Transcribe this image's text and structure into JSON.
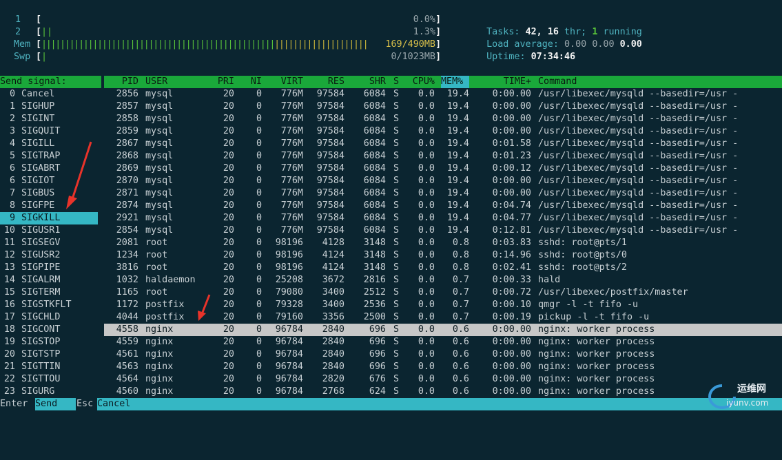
{
  "meters": {
    "cpu1": {
      "label": "1",
      "bar": "",
      "value": "0.0%"
    },
    "cpu2": {
      "label": "2",
      "bar": "||",
      "value": "1.3%"
    },
    "mem": {
      "label": "Mem",
      "bar_green": "||||||||||||||||||||||||||||||||||||||||||||||||||",
      "bar_yellow": "||||||||||||||||||||",
      "value": "169/490MB"
    },
    "swp": {
      "label": "Swp",
      "bar": "|",
      "value": "0/1023MB"
    }
  },
  "stats": {
    "tasks_label": "Tasks:",
    "tasks_count": "42,",
    "threads": "16",
    "thr_label": "thr;",
    "running": "1",
    "running_label": "running",
    "load_label": "Load average:",
    "load1": "0.00",
    "load5": "0.00",
    "load15": "0.00",
    "uptime_label": "Uptime:",
    "uptime": "07:34:46"
  },
  "signal_panel": {
    "title": "Send signal:",
    "items": [
      {
        "num": "0",
        "name": "Cancel"
      },
      {
        "num": "1",
        "name": "SIGHUP"
      },
      {
        "num": "2",
        "name": "SIGINT"
      },
      {
        "num": "3",
        "name": "SIGQUIT"
      },
      {
        "num": "4",
        "name": "SIGILL"
      },
      {
        "num": "5",
        "name": "SIGTRAP"
      },
      {
        "num": "6",
        "name": "SIGABRT"
      },
      {
        "num": "6",
        "name": "SIGIOT"
      },
      {
        "num": "7",
        "name": "SIGBUS"
      },
      {
        "num": "8",
        "name": "SIGFPE"
      },
      {
        "num": "9",
        "name": "SIGKILL"
      },
      {
        "num": "10",
        "name": "SIGUSR1"
      },
      {
        "num": "11",
        "name": "SIGSEGV"
      },
      {
        "num": "12",
        "name": "SIGUSR2"
      },
      {
        "num": "13",
        "name": "SIGPIPE"
      },
      {
        "num": "14",
        "name": "SIGALRM"
      },
      {
        "num": "15",
        "name": "SIGTERM"
      },
      {
        "num": "16",
        "name": "SIGSTKFLT"
      },
      {
        "num": "17",
        "name": "SIGCHLD"
      },
      {
        "num": "18",
        "name": "SIGCONT"
      },
      {
        "num": "19",
        "name": "SIGSTOP"
      },
      {
        "num": "20",
        "name": "SIGTSTP"
      },
      {
        "num": "21",
        "name": "SIGTTIN"
      },
      {
        "num": "22",
        "name": "SIGTTOU"
      },
      {
        "num": "23",
        "name": "SIGURG"
      }
    ],
    "selected_index": 10
  },
  "table": {
    "columns": [
      "PID",
      "USER",
      "PRI",
      "NI",
      "VIRT",
      "RES",
      "SHR",
      "S",
      "CPU%",
      "MEM%",
      "TIME+",
      "Command"
    ],
    "sorted_column": "MEM%",
    "rows": [
      [
        "2856",
        "mysql",
        "20",
        "0",
        "776M",
        "97584",
        "6084",
        "S",
        "0.0",
        "19.4",
        "0:00.00",
        "/usr/libexec/mysqld --basedir=/usr -"
      ],
      [
        "2857",
        "mysql",
        "20",
        "0",
        "776M",
        "97584",
        "6084",
        "S",
        "0.0",
        "19.4",
        "0:00.00",
        "/usr/libexec/mysqld --basedir=/usr -"
      ],
      [
        "2858",
        "mysql",
        "20",
        "0",
        "776M",
        "97584",
        "6084",
        "S",
        "0.0",
        "19.4",
        "0:00.00",
        "/usr/libexec/mysqld --basedir=/usr -"
      ],
      [
        "2859",
        "mysql",
        "20",
        "0",
        "776M",
        "97584",
        "6084",
        "S",
        "0.0",
        "19.4",
        "0:00.00",
        "/usr/libexec/mysqld --basedir=/usr -"
      ],
      [
        "2867",
        "mysql",
        "20",
        "0",
        "776M",
        "97584",
        "6084",
        "S",
        "0.0",
        "19.4",
        "0:01.58",
        "/usr/libexec/mysqld --basedir=/usr -"
      ],
      [
        "2868",
        "mysql",
        "20",
        "0",
        "776M",
        "97584",
        "6084",
        "S",
        "0.0",
        "19.4",
        "0:01.23",
        "/usr/libexec/mysqld --basedir=/usr -"
      ],
      [
        "2869",
        "mysql",
        "20",
        "0",
        "776M",
        "97584",
        "6084",
        "S",
        "0.0",
        "19.4",
        "0:00.12",
        "/usr/libexec/mysqld --basedir=/usr -"
      ],
      [
        "2870",
        "mysql",
        "20",
        "0",
        "776M",
        "97584",
        "6084",
        "S",
        "0.0",
        "19.4",
        "0:00.00",
        "/usr/libexec/mysqld --basedir=/usr -"
      ],
      [
        "2871",
        "mysql",
        "20",
        "0",
        "776M",
        "97584",
        "6084",
        "S",
        "0.0",
        "19.4",
        "0:00.00",
        "/usr/libexec/mysqld --basedir=/usr -"
      ],
      [
        "2874",
        "mysql",
        "20",
        "0",
        "776M",
        "97584",
        "6084",
        "S",
        "0.0",
        "19.4",
        "0:04.74",
        "/usr/libexec/mysqld --basedir=/usr -"
      ],
      [
        "2921",
        "mysql",
        "20",
        "0",
        "776M",
        "97584",
        "6084",
        "S",
        "0.0",
        "19.4",
        "0:04.77",
        "/usr/libexec/mysqld --basedir=/usr -"
      ],
      [
        "2854",
        "mysql",
        "20",
        "0",
        "776M",
        "97584",
        "6084",
        "S",
        "0.0",
        "19.4",
        "0:12.81",
        "/usr/libexec/mysqld --basedir=/usr -"
      ],
      [
        "2081",
        "root",
        "20",
        "0",
        "98196",
        "4128",
        "3148",
        "S",
        "0.0",
        "0.8",
        "0:03.83",
        "sshd: root@pts/1"
      ],
      [
        "1234",
        "root",
        "20",
        "0",
        "98196",
        "4124",
        "3148",
        "S",
        "0.0",
        "0.8",
        "0:14.96",
        "sshd: root@pts/0"
      ],
      [
        "3816",
        "root",
        "20",
        "0",
        "98196",
        "4124",
        "3148",
        "S",
        "0.0",
        "0.8",
        "0:02.41",
        "sshd: root@pts/2"
      ],
      [
        "1032",
        "haldaemon",
        "20",
        "0",
        "25208",
        "3672",
        "2816",
        "S",
        "0.0",
        "0.7",
        "0:00.33",
        "hald"
      ],
      [
        "1165",
        "root",
        "20",
        "0",
        "79080",
        "3400",
        "2512",
        "S",
        "0.0",
        "0.7",
        "0:00.72",
        "/usr/libexec/postfix/master"
      ],
      [
        "1172",
        "postfix",
        "20",
        "0",
        "79328",
        "3400",
        "2536",
        "S",
        "0.0",
        "0.7",
        "0:00.10",
        "qmgr -l -t fifo -u"
      ],
      [
        "4044",
        "postfix",
        "20",
        "0",
        "79160",
        "3356",
        "2500",
        "S",
        "0.0",
        "0.7",
        "0:00.19",
        "pickup -l -t fifo -u"
      ],
      [
        "4558",
        "nginx",
        "20",
        "0",
        "96784",
        "2840",
        "696",
        "S",
        "0.0",
        "0.6",
        "0:00.00",
        "nginx: worker process"
      ],
      [
        "4559",
        "nginx",
        "20",
        "0",
        "96784",
        "2840",
        "696",
        "S",
        "0.0",
        "0.6",
        "0:00.00",
        "nginx: worker process"
      ],
      [
        "4561",
        "nginx",
        "20",
        "0",
        "96784",
        "2840",
        "696",
        "S",
        "0.0",
        "0.6",
        "0:00.00",
        "nginx: worker process"
      ],
      [
        "4563",
        "nginx",
        "20",
        "0",
        "96784",
        "2840",
        "696",
        "S",
        "0.0",
        "0.6",
        "0:00.00",
        "nginx: worker process"
      ],
      [
        "4564",
        "nginx",
        "20",
        "0",
        "96784",
        "2820",
        "676",
        "S",
        "0.0",
        "0.6",
        "0:00.00",
        "nginx: worker process"
      ],
      [
        "4560",
        "nginx",
        "20",
        "0",
        "96784",
        "2768",
        "624",
        "S",
        "0.0",
        "0.6",
        "0:00.00",
        "nginx: worker process"
      ]
    ],
    "selected_index": 19
  },
  "footer": {
    "key1": "Enter",
    "label1": "Send  ",
    "key2": "Esc",
    "label2": "Cancel"
  },
  "annotations": {
    "arrow_color": "#e8332a",
    "arrow_count": 2
  },
  "watermark": {
    "text": "运维网",
    "url_text": "iyunv.com"
  }
}
